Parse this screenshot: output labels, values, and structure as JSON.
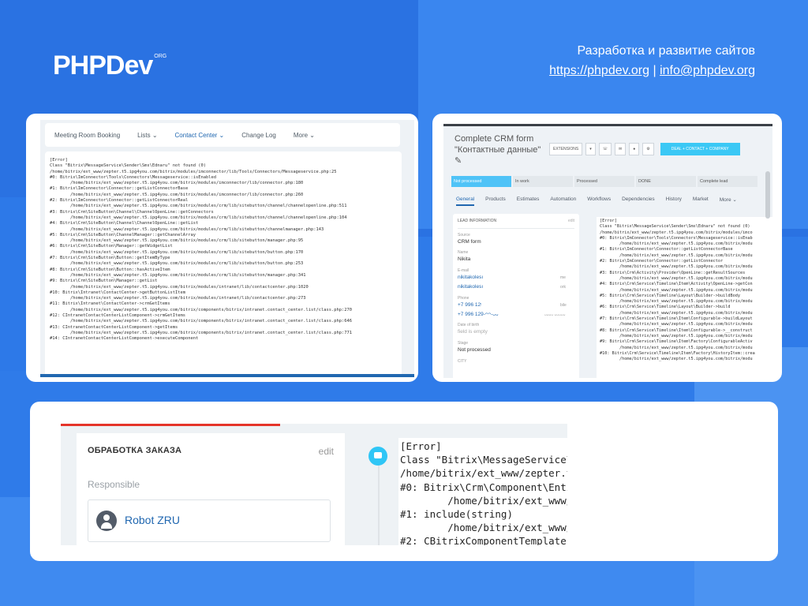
{
  "header": {
    "logo_text": "PHPDev",
    "logo_sup": "ORG",
    "tagline": "Разработка и развитие сайтов",
    "url": "https://phpdev.org",
    "separator": "|",
    "email": "info@phpdev.org"
  },
  "shot1": {
    "nav": [
      "Meeting Room Booking",
      "Lists ⌄",
      "Contact Center ⌄",
      "Change Log",
      "More ⌄"
    ],
    "log": "[Error]\nClass \"Bitrix\\MessageService\\Sender\\Sms\\Ednaru\" not found (0)\n/home/bitrix/ext_www/zepter.t5.ipg4you.com/bitrix/modules/imconnector/lib/Tools/Connectors/Messageservice.php:25\n#0: Bitrix\\ImConnector\\Tools\\Connectors\\Messageservice::isEnabled\n        /home/bitrix/ext_www/zepter.t5.ipg4you.com/bitrix/modules/imconnector/lib/connector.php:180\n#1: Bitrix\\ImConnector\\Connector::getListConnectorBase\n        /home/bitrix/ext_www/zepter.t5.ipg4you.com/bitrix/modules/imconnector/lib/connector.php:260\n#2: Bitrix\\ImConnector\\Connector::getListConnectorReal\n        /home/bitrix/ext_www/zepter.t5.ipg4you.com/bitrix/modules/crm/lib/sitebutton/channel/channelopenline.php:511\n#3: Bitrix\\Crm\\SiteButton\\Channel\\ChannelOpenLine::getConnectors\n        /home/bitrix/ext_www/zepter.t5.ipg4you.com/bitrix/modules/crm/lib/sitebutton/channel/channelopenline.php:104\n#4: Bitrix\\Crm\\SiteButton\\Channel\\ChannelOpenLine::getList\n        /home/bitrix/ext_www/zepter.t5.ipg4you.com/bitrix/modules/crm/lib/sitebutton/channelmanager.php:143\n#5: Bitrix\\Crm\\SiteButton\\ChannelManager::getChannelArray\n        /home/bitrix/ext_www/zepter.t5.ipg4you.com/bitrix/modules/crm/lib/sitebutton/manager.php:95\n#6: Bitrix\\Crm\\SiteButton\\Manager::getWidgetList\n        /home/bitrix/ext_www/zepter.t5.ipg4you.com/bitrix/modules/crm/lib/sitebutton/button.php:170\n#7: Bitrix\\Crm\\SiteButton\\Button::getItemByType\n        /home/bitrix/ext_www/zepter.t5.ipg4you.com/bitrix/modules/crm/lib/sitebutton/button.php:253\n#8: Bitrix\\Crm\\SiteButton\\Button::hasActiveItem\n        /home/bitrix/ext_www/zepter.t5.ipg4you.com/bitrix/modules/crm/lib/sitebutton/manager.php:341\n#9: Bitrix\\Crm\\SiteButton\\Manager::getList\n        /home/bitrix/ext_www/zepter.t5.ipg4you.com/bitrix/modules/intranet/lib/contactcenter.php:1020\n#10: Bitrix\\Intranet\\ContactCenter->getButtonListItem\n        /home/bitrix/ext_www/zepter.t5.ipg4you.com/bitrix/modules/intranet/lib/contactcenter.php:273\n#11: Bitrix\\Intranet\\ContactCenter->crmGetItems\n        /home/bitrix/ext_www/zepter.t5.ipg4you.com/bitrix/components/bitrix/intranet.contact_center.list/class.php:270\n#12: CIntranetContactCenterListComponent->crmGetItems\n        /home/bitrix/ext_www/zepter.t5.ipg4you.com/bitrix/components/bitrix/intranet.contact_center.list/class.php:646\n#13: CIntranetContactCenterListComponent->getItems\n        /home/bitrix/ext_www/zepter.t5.ipg4you.com/bitrix/components/bitrix/intranet.contact_center.list/class.php:771\n#14: CIntranetContactCenterListComponent->executeComponent"
  },
  "shot2": {
    "title": "Complete CRM form \"Контактные данные\" ✎",
    "btn_extensions": "EXTENSIONS",
    "btn_caret": "▾",
    "btn_call": "☏",
    "btn_mail": "✉",
    "btn_chat": "●",
    "btn_gear": "⚙",
    "btn_deal": "DEAL + CONTACT + COMPANY",
    "stages": [
      "Not processed",
      "In work",
      "Processed",
      "DONE",
      "Complete lead"
    ],
    "tabs": [
      "General",
      "Products",
      "Estimates",
      "Automation",
      "Workflows",
      "Dependencies",
      "History",
      "Market",
      "More ⌄"
    ],
    "info_header": "LEAD INFORMATION",
    "info_edit": "edit",
    "source_label": "Source",
    "source_value": "CRM form",
    "name_label": "Name",
    "name_value": "Nikita",
    "email_label": "E-mail",
    "email1": "nikitakolesı",
    "email1_type": "me",
    "email2": "nikitakolesı",
    "email2_type": "ork",
    "phone_label": "Phone",
    "phone1": "+7 996 12ᵎ",
    "phone1_type": "bile",
    "phone2": "+7 996 129-ᴖᴖ-ᴗᴗ",
    "phone2_type": "ᴗᴗᴗᴗ ᴗᴗᴗᴗᴗ",
    "dob_label": "Date of birth",
    "dob_value": "field is empty",
    "stage_label": "Stage",
    "stage_value": "Not processed",
    "city_label": "CITY",
    "log": "[Error]\nClass \"Bitrix\\MessageService\\Sender\\Sms\\Ednaru\" not found (0)\n/home/bitrix/ext_www/zepter.t5.ipg4you.com/bitrix/modules/imco\n#0: Bitrix\\ImConnector\\Tools\\Connectors\\Messageservice::isEnab\n        /home/bitrix/ext_www/zepter.t5.ipg4you.com/bitrix/modu\n#1: Bitrix\\ImConnector\\Connector::getListConnectorBase\n        /home/bitrix/ext_www/zepter.t5.ipg4you.com/bitrix/modu\n#2: Bitrix\\ImConnector\\Connector::getListConnector\n        /home/bitrix/ext_www/zepter.t5.ipg4you.com/bitrix/modu\n#3: Bitrix\\Crm\\Activity\\Provider\\OpenLine::getResultSources\n        /home/bitrix/ext_www/zepter.t5.ipg4you.com/bitrix/modu\n#4: Bitrix\\Crm\\Service\\Timeline\\Item\\Activity\\OpenLine->getCon\n        /home/bitrix/ext_www/zepter.t5.ipg4you.com/bitrix/modu\n#5: Bitrix\\Crm\\Service\\Timeline\\Layout\\Builder->buildBody\n        /home/bitrix/ext_www/zepter.t5.ipg4you.com/bitrix/modu\n#6: Bitrix\\Crm\\Service\\Timeline\\Layout\\Builder->build\n        /home/bitrix/ext_www/zepter.t5.ipg4you.com/bitrix/modu\n#7: Bitrix\\Crm\\Service\\Timeline\\Item\\Configurable->buildLayout\n        /home/bitrix/ext_www/zepter.t5.ipg4you.com/bitrix/modu\n#8: Bitrix\\Crm\\Service\\Timeline\\Item\\Configurable->__construct\n        /home/bitrix/ext_www/zepter.t5.ipg4you.com/bitrix/modu\n#9: Bitrix\\Crm\\Service\\Timeline\\Item\\Factory\\ConfigurableActiv\n        /home/bitrix/ext_www/zepter.t5.ipg4you.com/bitrix/modu\n#10: Bitrix\\Crm\\Service\\Timeline\\Item\\Factory\\HistoryItem::crea\n        /home/bitrix/ext_www/zepter.t5.ipg4you.com/bitrix/modu"
  },
  "shot3": {
    "panel_title": "ОБРАБОТКА ЗАКАЗА",
    "panel_edit": "edit",
    "responsible_label": "Responsible",
    "robot_name": "Robot ZRU",
    "code": "[Error]\nClass \"Bitrix\\MessageService\\S\n/home/bitrix/ext_www/zepter.t5\n#0: Bitrix\\Crm\\Component\\Entit\n        /home/bitrix/ext_www/z\n#1: include(string)\n        /home/bitrix/ext_www/z\n#2: CBitrixComponentTemplate->\n        /home/bitrix/ext_www/z"
  },
  "colors": {
    "background": "#2f7be9",
    "link_blue": "#2067b0",
    "accent_cyan": "#2fc6f6",
    "error_red": "#e5342a"
  }
}
